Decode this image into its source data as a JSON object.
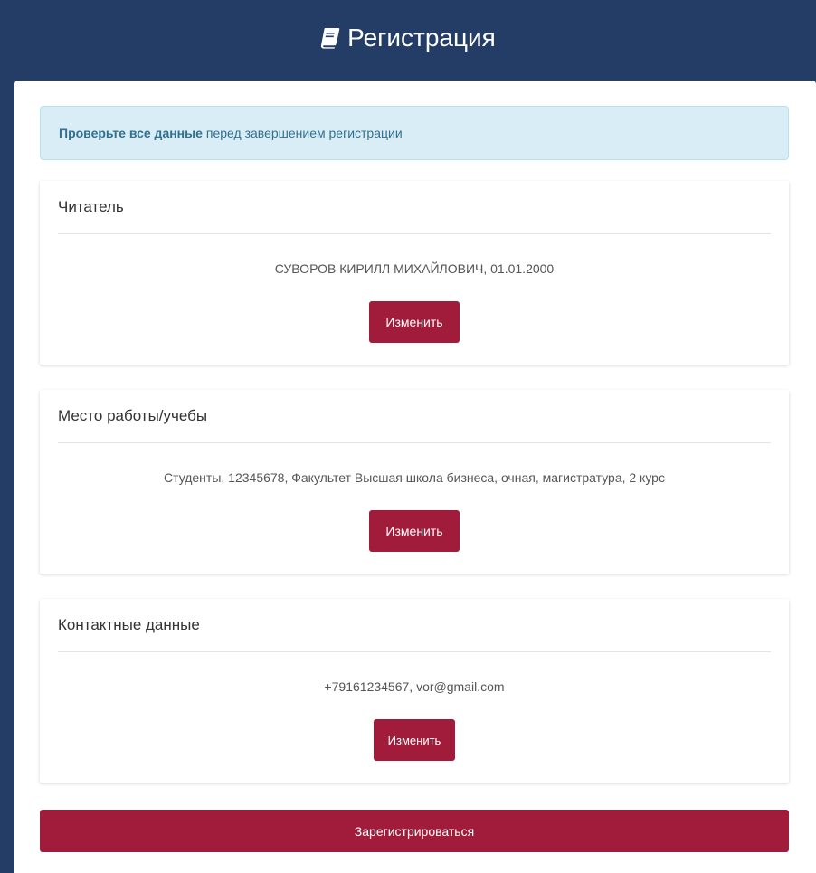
{
  "header": {
    "title": "Регистрация",
    "icon": "book-icon"
  },
  "alert": {
    "bold_text": "Проверьте все данные",
    "text": "перед завершением регистрации"
  },
  "sections": [
    {
      "title": "Читатель",
      "value": "СУВОРОВ КИРИЛЛ МИХАЙЛОВИЧ, 01.01.2000",
      "button_label": "Изменить"
    },
    {
      "title": "Место работы/учебы",
      "value": "Студенты, 12345678, Факультет Высшая школа бизнеса, очная, магистратура, 2 курс",
      "button_label": "Изменить"
    },
    {
      "title": "Контактные данные",
      "value": "+79161234567, vor@gmail.com",
      "button_label": "Изменить"
    }
  ],
  "register_button": {
    "label": "Зарегистрироваться"
  },
  "colors": {
    "header_bg": "#233d66",
    "accent": "#a11c3a",
    "alert_bg": "#d9edf6",
    "alert_text": "#31708f"
  }
}
